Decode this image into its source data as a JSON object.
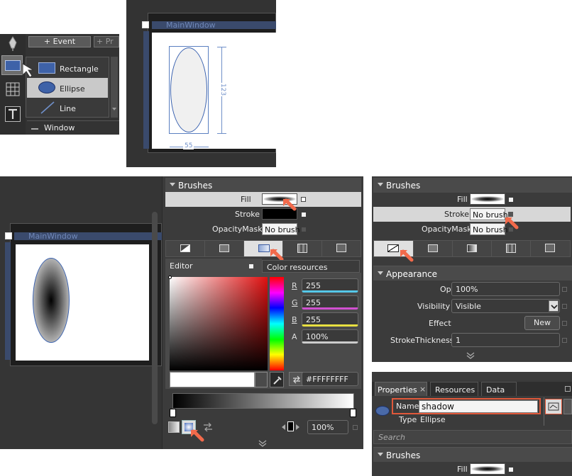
{
  "toolbar": {
    "event_button": "+ Event",
    "second_button": "+ Pr",
    "cut_label": "Wi",
    "window_item": "Window"
  },
  "shape_menu": {
    "items": [
      {
        "label": "Rectangle",
        "icon": "rectangle-icon"
      },
      {
        "label": "Ellipse",
        "icon": "ellipse-icon"
      },
      {
        "label": "Line",
        "icon": "line-icon"
      }
    ]
  },
  "canvas1": {
    "window_title": "MainWindow",
    "height_label": "123",
    "width_label": "55"
  },
  "canvas2": {
    "window_title": "MainWindow"
  },
  "brushes_panel_a": {
    "header": "Brushes",
    "fill_label": "Fill",
    "stroke_label": "Stroke",
    "opacity_mask_label": "OpacityMask",
    "opacity_mask_value": "No brush",
    "editor_tab": "Editor",
    "color_resources_tab": "Color resources",
    "r_label": "R",
    "r_value": "255",
    "g_label": "G",
    "g_value": "255",
    "b_label": "B",
    "b_value": "255",
    "a_label": "A",
    "a_value": "100%",
    "hex_value": "#FFFFFFFF",
    "stop_offset": "100%"
  },
  "brushes_panel_b": {
    "header": "Brushes",
    "fill_label": "Fill",
    "stroke_label": "Stroke",
    "stroke_value": "No brush",
    "opacity_mask_label": "OpacityMask",
    "opacity_mask_value": "No brush"
  },
  "appearance": {
    "header": "Appearance",
    "opacity_label": "Opacity",
    "opacity_value": "100%",
    "visibility_label": "Visibility",
    "visibility_value": "Visible",
    "effect_label": "Effect",
    "effect_button": "New",
    "stroke_thickness_label": "StrokeThickness",
    "stroke_thickness_value": "1"
  },
  "properties": {
    "tabs": [
      {
        "label": "Properties",
        "close": "×"
      },
      {
        "label": "Resources"
      },
      {
        "label": "Data"
      }
    ],
    "name_label": "Name",
    "name_value": "shadow",
    "type_label": "Type",
    "type_value": "Ellipse",
    "search_placeholder": "Search",
    "brushes_header": "Brushes",
    "fill_label": "Fill"
  },
  "colors": {
    "highlight": "#e0583a",
    "accent_blue": "#4a6aa8",
    "panel_bg": "#3b3b3b"
  }
}
